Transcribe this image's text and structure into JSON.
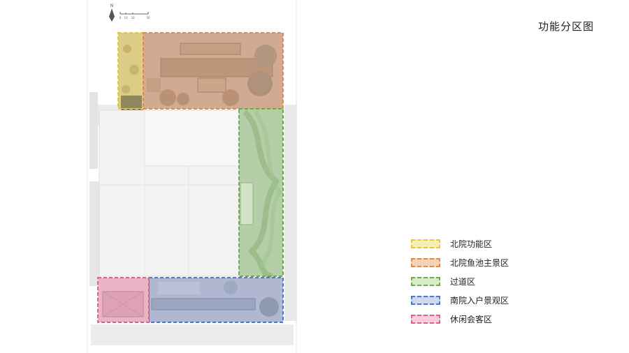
{
  "title": "功能分区图",
  "north_label": "N",
  "scale_labels": [
    "0",
    "10",
    "20",
    "50"
  ],
  "legend": [
    {
      "label": "北院功能区",
      "stroke": "#e8c830",
      "fill": "#f7efb8"
    },
    {
      "label": "北院鱼池主景区",
      "stroke": "#e08a4a",
      "fill": "#f3d3b8"
    },
    {
      "label": "过道区",
      "stroke": "#6aae45",
      "fill": "#d6ebc8"
    },
    {
      "label": "南院入户景观区",
      "stroke": "#4f76c8",
      "fill": "#cdd8f0"
    },
    {
      "label": "休闲会客区",
      "stroke": "#e0608a",
      "fill": "#f6cfdb"
    }
  ]
}
